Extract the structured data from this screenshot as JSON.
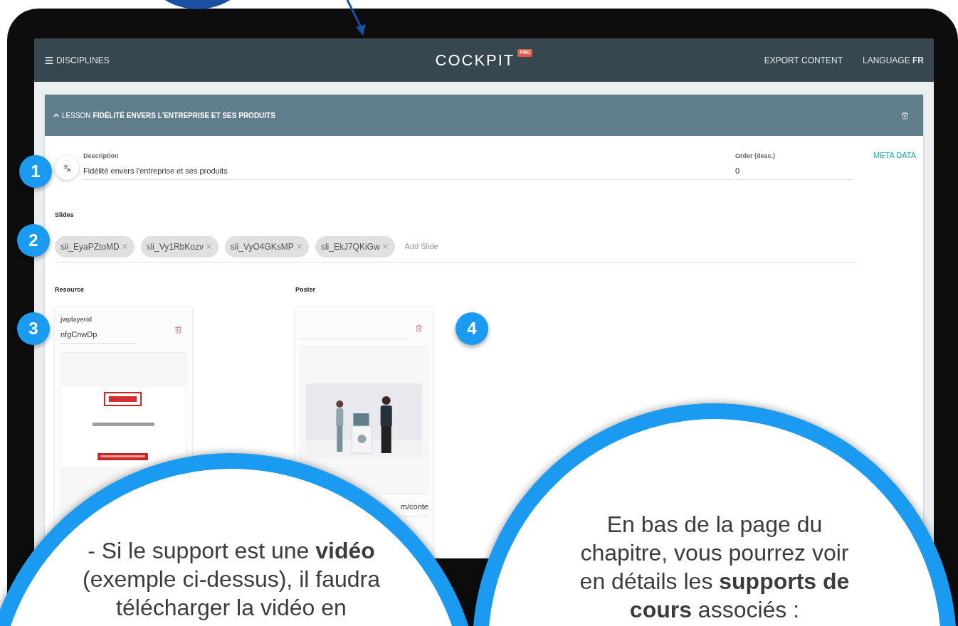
{
  "header": {
    "menu": "DISCIPLINES",
    "logo": "COCKPIT",
    "badge": "PRO",
    "actions": [
      {
        "label": "EXPORT CONTENT"
      },
      {
        "label": "LANGUAGE **FR**"
      }
    ]
  },
  "lesson": {
    "prefix": "LESSON",
    "title": "FIDÉLITÉ ENVERS L'ENTREPRISE ET SES PRODUITS",
    "expanded": true
  },
  "description": {
    "label": "Description",
    "value": "Fidélité envers l'entreprise et ses produits"
  },
  "order": {
    "label": "Order (desc.)",
    "value": "0"
  },
  "meta_link": "META DATA",
  "slides": {
    "label": "Slides",
    "chips": [
      "sli_EyaPZtoMD",
      "sli_Vy1RbKozv",
      "sli_VyO4GKsMP",
      "sli_EkJ7QKiGw"
    ],
    "placeholder": "Add Slide"
  },
  "resource": {
    "label": "Resource",
    "field_label": "jwplayerid",
    "value": "nfgCnwDp"
  },
  "poster": {
    "label": "Poster",
    "url_fragment": "m/conte"
  },
  "markers": [
    "1",
    "2",
    "3",
    "4"
  ],
  "notes": [
    {
      "text": "-  Si le support est une **vidéo**\n(exemple ci-dessus), il faudra\ntélécharger la vidéo en"
    },
    {
      "text": "En bas de la page du\nchapitre, vous pourrez voir\nen détails les **supports de\ncours** associés :"
    }
  ]
}
